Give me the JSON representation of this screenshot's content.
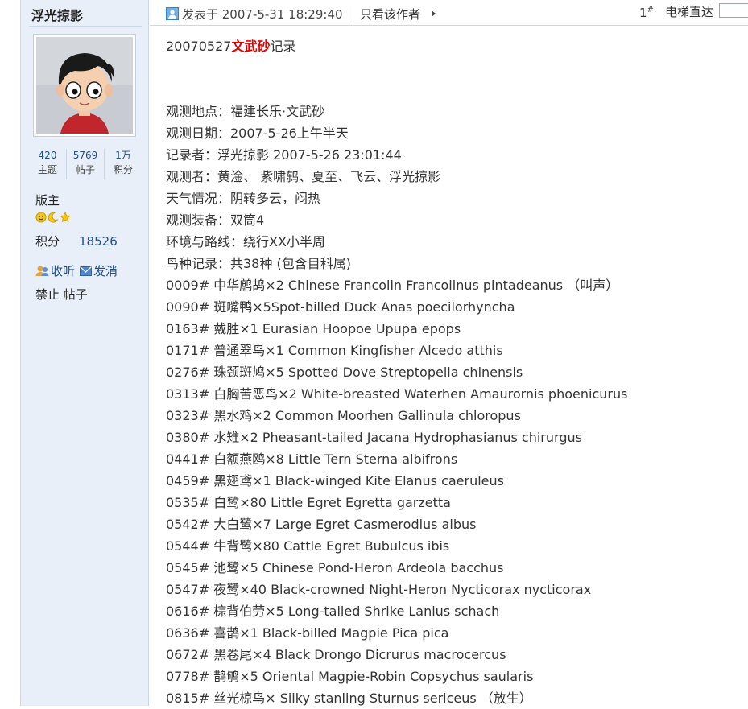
{
  "user": {
    "name": "浮光掠影",
    "stats": [
      {
        "value": "420",
        "label": "主题"
      },
      {
        "value": "5769",
        "label": "帖子"
      },
      {
        "value": "1万",
        "label": "积分"
      }
    ],
    "role": "版主",
    "points_label": "积分",
    "points_value": "18526",
    "actions": {
      "follow": "收听",
      "message": "发消"
    },
    "ban": "禁止 帖子"
  },
  "post_header": {
    "posted_at": "发表于 2007-5-31 18:29:40",
    "only_author": "只看该作者",
    "floor": "1",
    "floor_sup": "#",
    "jump_label": "电梯直达"
  },
  "post": {
    "title_prefix": "20070527",
    "title_highlight": "文武砂",
    "title_suffix": "记录",
    "lines": [
      "观测地点：福建长乐·文武砂",
      "观测日期：2007-5-26上午半天",
      "记录者：浮光掠影  2007-5-26 23:01:44",
      "观测者：黄淦、 紫啸鸫、夏至、飞云、浮光掠影",
      "天气情况：阴转多云，闷热",
      "观测装备：双筒4",
      "环境与路线：绕行XX小半周",
      "鸟种记录：共38种 (包含目科属)",
      "0009#  中华鹧鸪×2 Chinese Francolin Francolinus pintadeanus   （叫声）",
      "0090#  斑嘴鸭×5Spot-billed Duck Anas poecilorhyncha",
      "0163#  戴胜×1 Eurasian Hoopoe Upupa epops",
      "0171#  普通翠鸟×1 Common Kingfisher Alcedo atthis",
      "0276#  珠颈斑鸠×5 Spotted Dove Streptopelia chinensis",
      "0313#  白胸苦恶鸟×2 White-breasted Waterhen Amaurornis phoenicurus",
      "0323#  黑水鸡×2 Common Moorhen Gallinula chloropus",
      "0380#  水雉×2 Pheasant-tailed Jacana Hydrophasianus chirurgus",
      "0441#  白额燕鸥×8 Little Tern Sterna albifrons",
      "0459#  黑翅鸢×1 Black-winged Kite Elanus caeruleus",
      "0535#  白鹭×80 Little Egret Egretta garzetta",
      "0542#  大白鹭×7 Large Egret Casmerodius albus",
      "0544#  牛背鹭×80 Cattle Egret Bubulcus ibis",
      "0545#  池鹭×5 Chinese Pond-Heron Ardeola bacchus",
      "0547#  夜鹭×40 Black-crowned Night-Heron Nycticorax nycticorax",
      "0616#  棕背伯劳×5 Long-tailed Shrike Lanius schach",
      "0636#  喜鹊×1 Black-billed Magpie Pica pica",
      "0672#  黑卷尾×4 Black Drongo Dicrurus macrocercus",
      "0778#  鹊鸲×5 Oriental Magpie-Robin Copsychus saularis",
      "0815#  丝光椋鸟× Silky stanling Sturnus sericeus  （放生）"
    ]
  },
  "colors": {
    "sidebar_bg": "#e8eff8",
    "link_blue": "#1e4f8f",
    "highlight_red": "#e00000"
  },
  "icons": [
    "avatar-image",
    "post-icon",
    "arrow-right-icon",
    "smile-medal-icon",
    "moon-medal-icon",
    "star-medal-icon",
    "follow-icon",
    "mail-icon"
  ]
}
